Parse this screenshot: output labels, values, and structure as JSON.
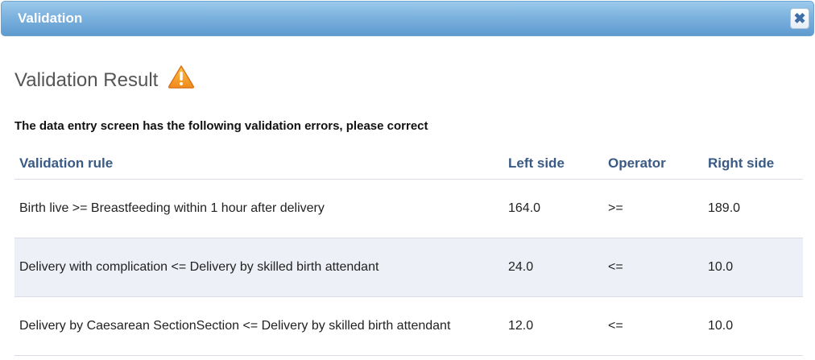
{
  "dialog": {
    "title": "Validation",
    "close_icon": "close-icon"
  },
  "result": {
    "heading": "Validation Result",
    "warning_icon": "warning-triangle-icon",
    "intro": "The data entry screen has the following validation errors, please correct"
  },
  "table": {
    "headers": {
      "rule": "Validation rule",
      "left": "Left side",
      "operator": "Operator",
      "right": "Right side"
    },
    "rows": [
      {
        "rule": "Birth live >= Breastfeeding within 1 hour after delivery",
        "left": "164.0",
        "operator": ">=",
        "right": "189.0"
      },
      {
        "rule": "Delivery with complication <= Delivery by skilled birth attendant",
        "left": "24.0",
        "operator": "<=",
        "right": "10.0"
      },
      {
        "rule": "Delivery by Caesarean SectionSection <= Delivery by skilled birth attendant",
        "left": "12.0",
        "operator": "<=",
        "right": "10.0"
      }
    ]
  },
  "colors": {
    "titlebar": "#7cb2de",
    "header_text": "#3a5a86",
    "alt_row": "#edf0f6",
    "warning": "#f39c12"
  }
}
